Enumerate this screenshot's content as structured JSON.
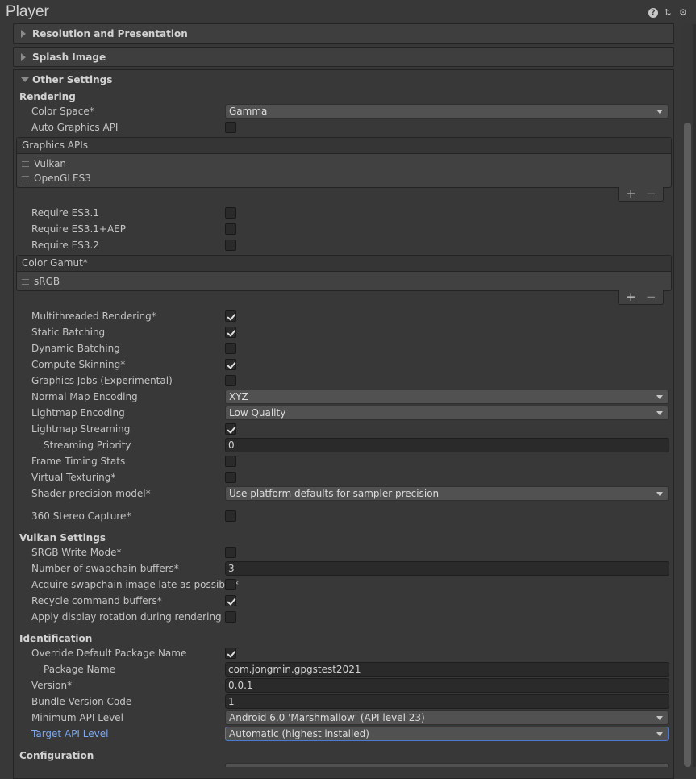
{
  "window": {
    "title": "Player"
  },
  "toolbar": {
    "help_icon": "help-icon",
    "preset_icon": "presets-icon",
    "settings_icon": "gear-icon"
  },
  "sections": {
    "resolution": "Resolution and Presentation",
    "splash": "Splash Image",
    "other": "Other Settings"
  },
  "rendering": {
    "header": "Rendering",
    "color_space_label": "Color Space*",
    "color_space_value": "Gamma",
    "auto_graphics_label": "Auto Graphics API",
    "graphics_apis": {
      "header": "Graphics APIs",
      "items": [
        "Vulkan",
        "OpenGLES3"
      ]
    },
    "require_es31_label": "Require ES3.1",
    "require_es31_aep_label": "Require ES3.1+AEP",
    "require_es32_label": "Require ES3.2",
    "color_gamut": {
      "header": "Color Gamut*",
      "items": [
        "sRGB"
      ]
    },
    "multithreaded_label": "Multithreaded Rendering*",
    "static_batching_label": "Static Batching",
    "dynamic_batching_label": "Dynamic Batching",
    "compute_skinning_label": "Compute Skinning*",
    "graphics_jobs_label": "Graphics Jobs (Experimental)",
    "normal_map_label": "Normal Map Encoding",
    "normal_map_value": "XYZ",
    "lightmap_encoding_label": "Lightmap Encoding",
    "lightmap_encoding_value": "Low Quality",
    "lightmap_streaming_label": "Lightmap Streaming",
    "streaming_priority_label": "Streaming Priority",
    "streaming_priority_value": "0",
    "frame_timing_label": "Frame Timing Stats",
    "virtual_texturing_label": "Virtual Texturing*",
    "shader_precision_label": "Shader precision model*",
    "shader_precision_value": "Use platform defaults for sampler precision",
    "stereo_capture_label": "360 Stereo Capture*"
  },
  "vulkan": {
    "header": "Vulkan Settings",
    "srgb_write_label": "SRGB Write Mode*",
    "swapchain_buffers_label": "Number of swapchain buffers*",
    "swapchain_buffers_value": "3",
    "acquire_late_label": "Acquire swapchain image late as possible*",
    "recycle_label": "Recycle command buffers*",
    "display_rotation_label": "Apply display rotation during rendering"
  },
  "identification": {
    "header": "Identification",
    "override_package_label": "Override Default Package Name",
    "package_name_label": "Package Name",
    "package_name_value": "com.jongmin.gpgstest2021",
    "version_label": "Version*",
    "version_value": "0.0.1",
    "bundle_code_label": "Bundle Version Code",
    "bundle_code_value": "1",
    "min_api_label": "Minimum API Level",
    "min_api_value": "Android 6.0 'Marshmallow' (API level 23)",
    "target_api_label": "Target API Level",
    "target_api_value": "Automatic (highest installed)"
  },
  "configuration": {
    "header": "Configuration"
  },
  "list_controls": {
    "add": "+",
    "remove": "−"
  },
  "checkbox_states": {
    "auto_graphics": false,
    "require_es31": false,
    "require_es31_aep": false,
    "require_es32": false,
    "multithreaded": true,
    "static_batching": true,
    "dynamic_batching": false,
    "compute_skinning": true,
    "graphics_jobs": false,
    "lightmap_streaming": true,
    "frame_timing": false,
    "virtual_texturing": false,
    "stereo_capture": false,
    "srgb_write": false,
    "acquire_late": false,
    "recycle": true,
    "display_rotation": false,
    "override_package": true
  },
  "colors": {
    "background": "#383838",
    "accent_blue": "#7ba8f0",
    "focus_border": "#4a7bd4"
  }
}
